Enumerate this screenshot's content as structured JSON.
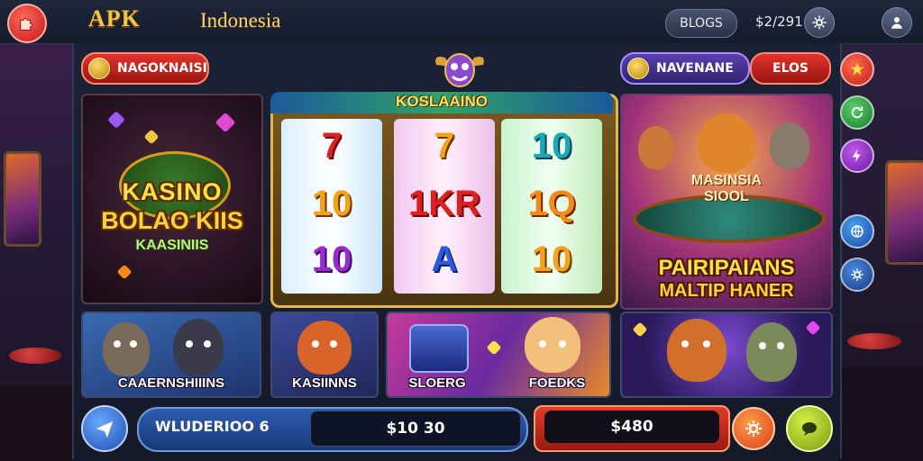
{
  "header": {
    "app_title": "APK",
    "region": "Indonesia",
    "blogs_label": "BLOGS",
    "balance": "$2/291"
  },
  "toolbar": {
    "left_pill_label": "NAGOKNAISI",
    "right_pill_label": "NAVENANE",
    "red_pill_label": "ELOS"
  },
  "slot": {
    "title": "KOSLAAINO",
    "reels": [
      [
        "7",
        "10",
        "10"
      ],
      [
        "7",
        "1KR",
        "A"
      ],
      [
        "10",
        "1Q",
        "10"
      ]
    ]
  },
  "tiles": {
    "kasino": {
      "line1": "KASINO",
      "line2": "BOLAO KIIS",
      "line3": "KAASINIIS"
    },
    "masinsia": {
      "sign1": "MASINSIA",
      "sign2": "SIOOL",
      "line1": "PAIRIPAIANS",
      "line2": "MALTIP HANER"
    },
    "bottom": [
      {
        "label": "CAAERNSHIIINS"
      },
      {
        "label": "KASIINNS"
      },
      {
        "label": "SLOERG",
        "label2": "FOEDKS"
      },
      {
        "label": ""
      }
    ]
  },
  "bottom_bar": {
    "left_label": "WLUDERIOO 6",
    "left_value": "$10 30",
    "right_value": "$480"
  },
  "colors": {
    "accent_red": "#e0342c",
    "accent_gold": "#f5c542",
    "accent_blue": "#2e5bb0"
  },
  "icons": {
    "logo": "puzzle-icon",
    "settings_top": "settings-icon",
    "profile_top": "profile-icon",
    "side": [
      "star-icon",
      "refresh-icon",
      "lightning-icon",
      "globe-icon",
      "gear-icon"
    ],
    "bottom_left": "send-icon",
    "bottom_gear": "gear-icon",
    "bottom_chat": "chat-icon"
  }
}
